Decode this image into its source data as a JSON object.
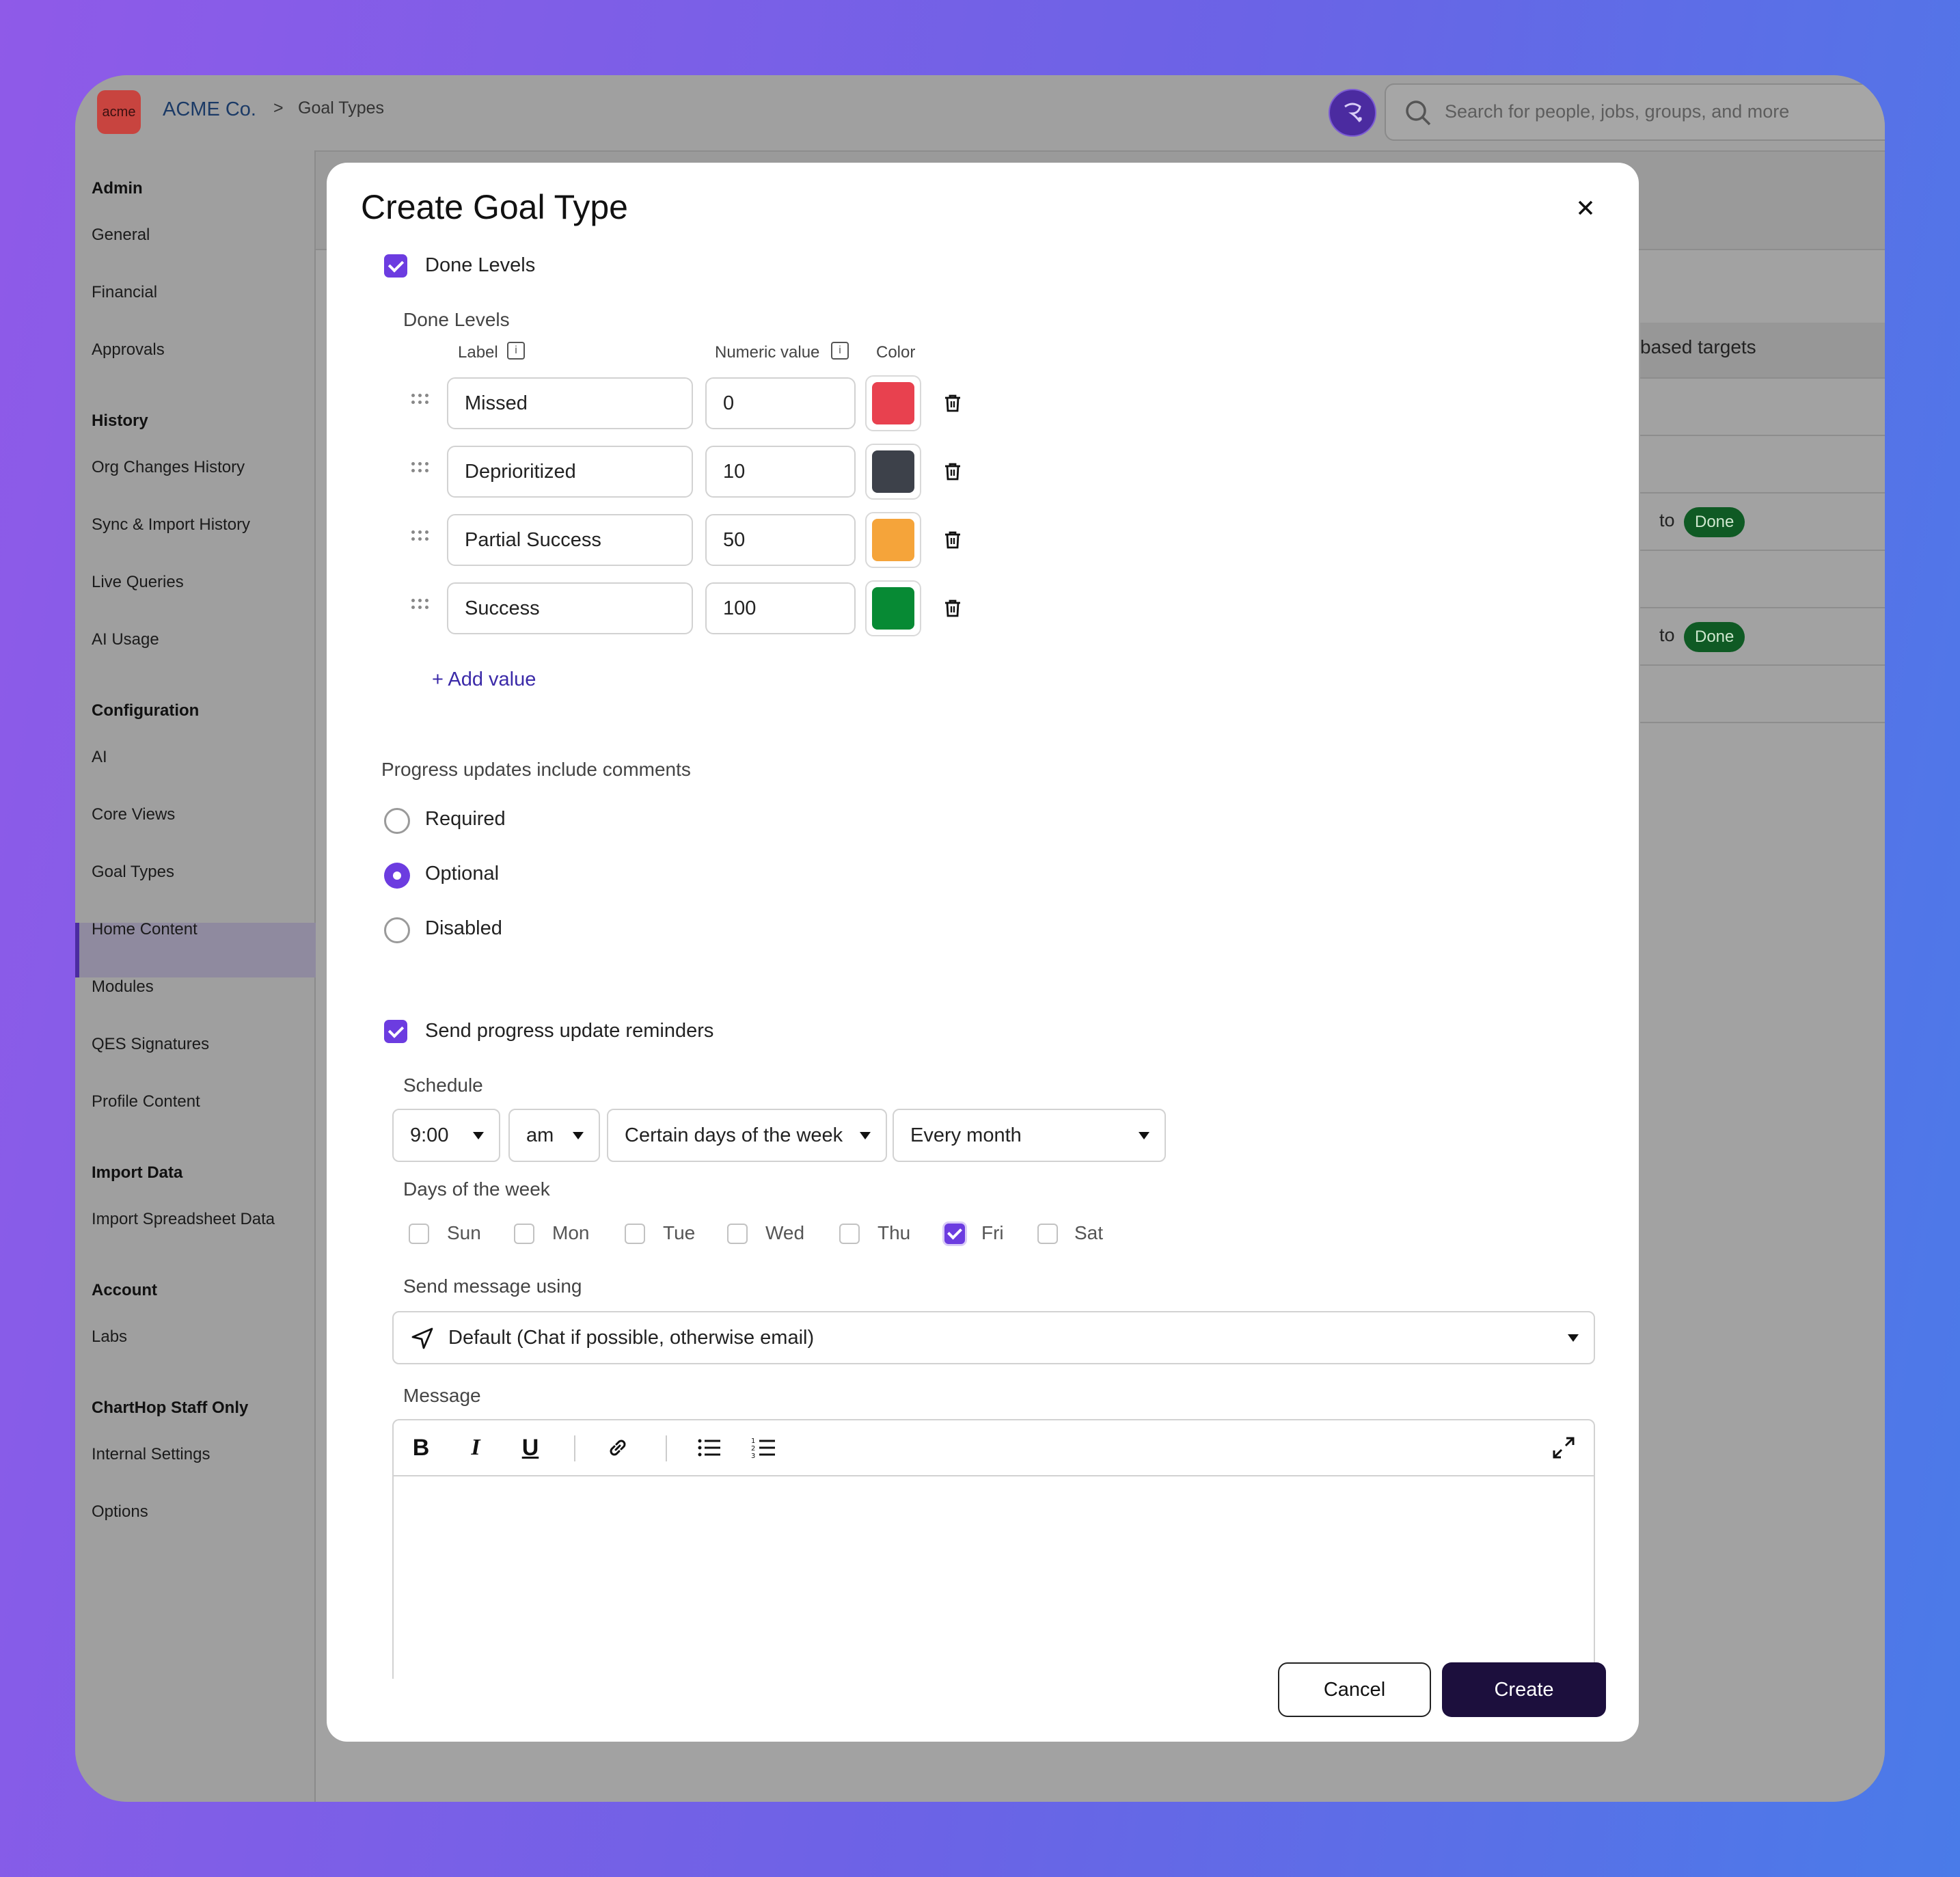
{
  "header": {
    "logo_text": "acme",
    "breadcrumb_org": "ACME Co.",
    "breadcrumb_sep": ">",
    "breadcrumb_page": "Goal Types",
    "search_placeholder": "Search for people, jobs, groups, and more"
  },
  "sidebar": {
    "sections": [
      {
        "heading": "Admin",
        "items": [
          "General",
          "Financial",
          "Approvals"
        ]
      },
      {
        "heading": "History",
        "items": [
          "Org Changes History",
          "Sync & Import History",
          "Live Queries",
          "AI Usage"
        ]
      },
      {
        "heading": "Configuration",
        "items": [
          "AI",
          "Core Views",
          "Goal Types",
          "Home Content",
          "Modules",
          "QES Signatures",
          "Profile Content"
        ]
      },
      {
        "heading": "Import Data",
        "items": [
          "Import Spreadsheet Data"
        ]
      },
      {
        "heading": "Account",
        "items": [
          "Labs"
        ]
      },
      {
        "heading": "ChartHop Staff Only",
        "items": [
          "Internal Settings",
          "Options"
        ]
      }
    ],
    "active_item": "Goal Types"
  },
  "background": {
    "column_header": "based targets",
    "row1_to": "to",
    "row1_badge": "Done",
    "row2_to": "to",
    "row2_badge": "Done"
  },
  "modal": {
    "title": "Create Goal Type",
    "done_levels_checkbox": "Done Levels",
    "done_levels_heading": "Done Levels",
    "col_label": "Label",
    "col_numeric": "Numeric value",
    "col_color": "Color",
    "levels": [
      {
        "label": "Missed",
        "value": "0",
        "color": "#e8414f"
      },
      {
        "label": "Deprioritized",
        "value": "10",
        "color": "#3d414a"
      },
      {
        "label": "Partial Success",
        "value": "50",
        "color": "#f5a43a"
      },
      {
        "label": "Success",
        "value": "100",
        "color": "#078a34"
      }
    ],
    "add_value": "+ Add value",
    "comments_heading": "Progress updates include comments",
    "comment_options": [
      "Required",
      "Optional",
      "Disabled"
    ],
    "comment_selected": "Optional",
    "reminders_checkbox": "Send progress update reminders",
    "schedule_heading": "Schedule",
    "schedule_time": "9:00",
    "schedule_ampm": "am",
    "schedule_mode": "Certain days of the week",
    "schedule_freq": "Every month",
    "days_heading": "Days of the week",
    "days": [
      {
        "name": "Sun",
        "checked": false
      },
      {
        "name": "Mon",
        "checked": false
      },
      {
        "name": "Tue",
        "checked": false
      },
      {
        "name": "Wed",
        "checked": false
      },
      {
        "name": "Thu",
        "checked": false
      },
      {
        "name": "Fri",
        "checked": true
      },
      {
        "name": "Sat",
        "checked": false
      }
    ],
    "send_using_heading": "Send message using",
    "send_using_value": "Default (Chat if possible, otherwise email)",
    "message_heading": "Message",
    "cancel_label": "Cancel",
    "create_label": "Create"
  },
  "colors": {
    "accent": "#6c3ce0",
    "primary_button": "#1c0f3d",
    "link": "#3b2aa8",
    "done_badge": "#0f5a24"
  }
}
